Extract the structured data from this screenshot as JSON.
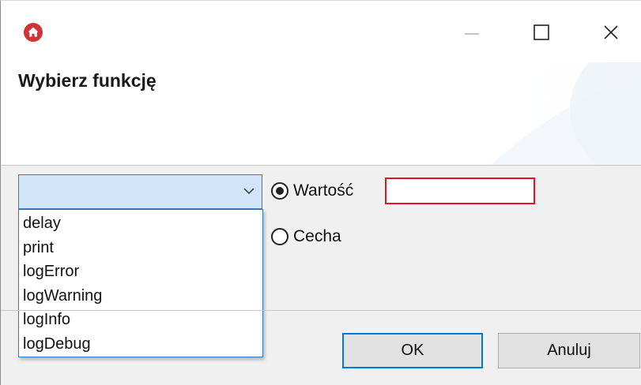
{
  "window": {
    "controls": {
      "minimize_icon": "minimize-icon",
      "maximize_icon": "maximize-icon",
      "close_icon": "close-icon"
    },
    "app_icon": "home-icon",
    "accent_color": "#d13438"
  },
  "header": {
    "title": "Wybierz funkcję"
  },
  "combo": {
    "selected": "",
    "items": [
      "delay",
      "print",
      "logError",
      "logWarning",
      "logInfo",
      "logDebug"
    ]
  },
  "options": {
    "value_label": "Wartość",
    "value_selected": true,
    "value_input": "",
    "feature_label": "Cecha",
    "feature_selected": false,
    "error_color": "#e81123"
  },
  "buttons": {
    "ok": "OK",
    "cancel": "Anuluj"
  }
}
